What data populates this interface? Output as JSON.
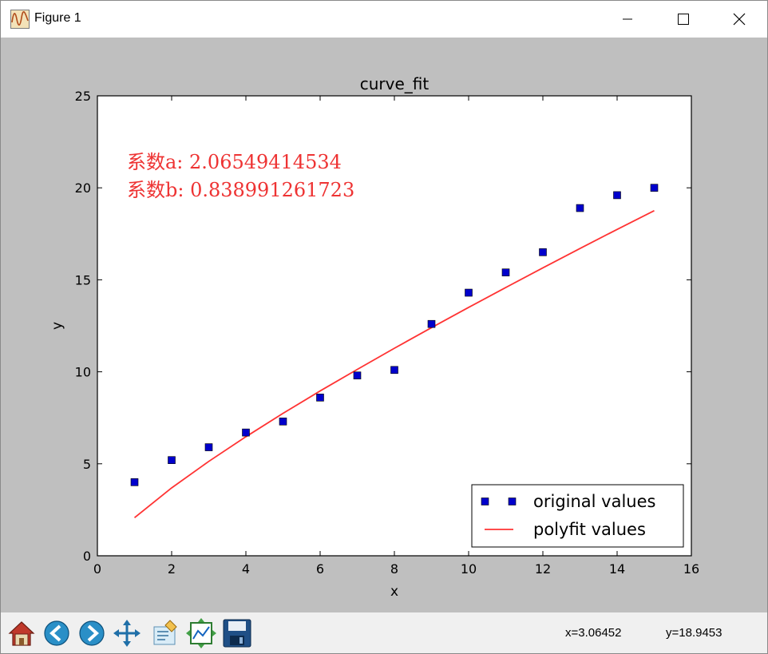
{
  "window": {
    "title": "Figure 1",
    "controls": [
      "minimize",
      "maximize",
      "close"
    ]
  },
  "toolbar": {
    "tools": [
      {
        "name": "home-icon"
      },
      {
        "name": "back-icon"
      },
      {
        "name": "forward-icon"
      },
      {
        "name": "pan-icon"
      },
      {
        "name": "zoom-rect-icon"
      },
      {
        "name": "subplots-icon"
      },
      {
        "name": "save-icon"
      }
    ],
    "x_readout": "x=3.06452",
    "y_readout": "y=18.9453"
  },
  "chart_data": {
    "type": "scatter",
    "title": "curve_fit",
    "xlabel": "x",
    "ylabel": "y",
    "xlim": [
      0,
      16
    ],
    "ylim": [
      0,
      25
    ],
    "xticks": [
      0,
      2,
      4,
      6,
      8,
      10,
      12,
      14,
      16
    ],
    "yticks": [
      0,
      5,
      10,
      15,
      20,
      25
    ],
    "grid": false,
    "legend_position": "lower-right",
    "series": [
      {
        "name": "original values",
        "kind": "markers",
        "marker": "square",
        "color": "#0000cc",
        "x": [
          1,
          2,
          3,
          4,
          5,
          6,
          7,
          8,
          9,
          10,
          11,
          12,
          13,
          14,
          15
        ],
        "y": [
          4.0,
          5.2,
          5.9,
          6.7,
          7.3,
          8.6,
          9.8,
          10.1,
          12.6,
          14.3,
          15.4,
          16.5,
          18.9,
          19.6,
          20.0
        ]
      },
      {
        "name": "polyfit values",
        "kind": "line",
        "color": "#ff3333",
        "x": [
          1,
          2,
          3,
          4,
          5,
          6,
          7,
          8,
          9,
          10,
          11,
          12,
          13,
          14,
          15
        ],
        "y": [
          2.07,
          3.69,
          5.13,
          6.47,
          7.74,
          8.96,
          10.13,
          11.28,
          12.4,
          13.5,
          14.58,
          15.65,
          16.7,
          17.74,
          18.76
        ]
      }
    ],
    "annotations": [
      {
        "text": "系数a: 2.06549414534",
        "color": "#ee3333"
      },
      {
        "text": "系数b: 0.838991261723",
        "color": "#ee3333"
      }
    ]
  }
}
